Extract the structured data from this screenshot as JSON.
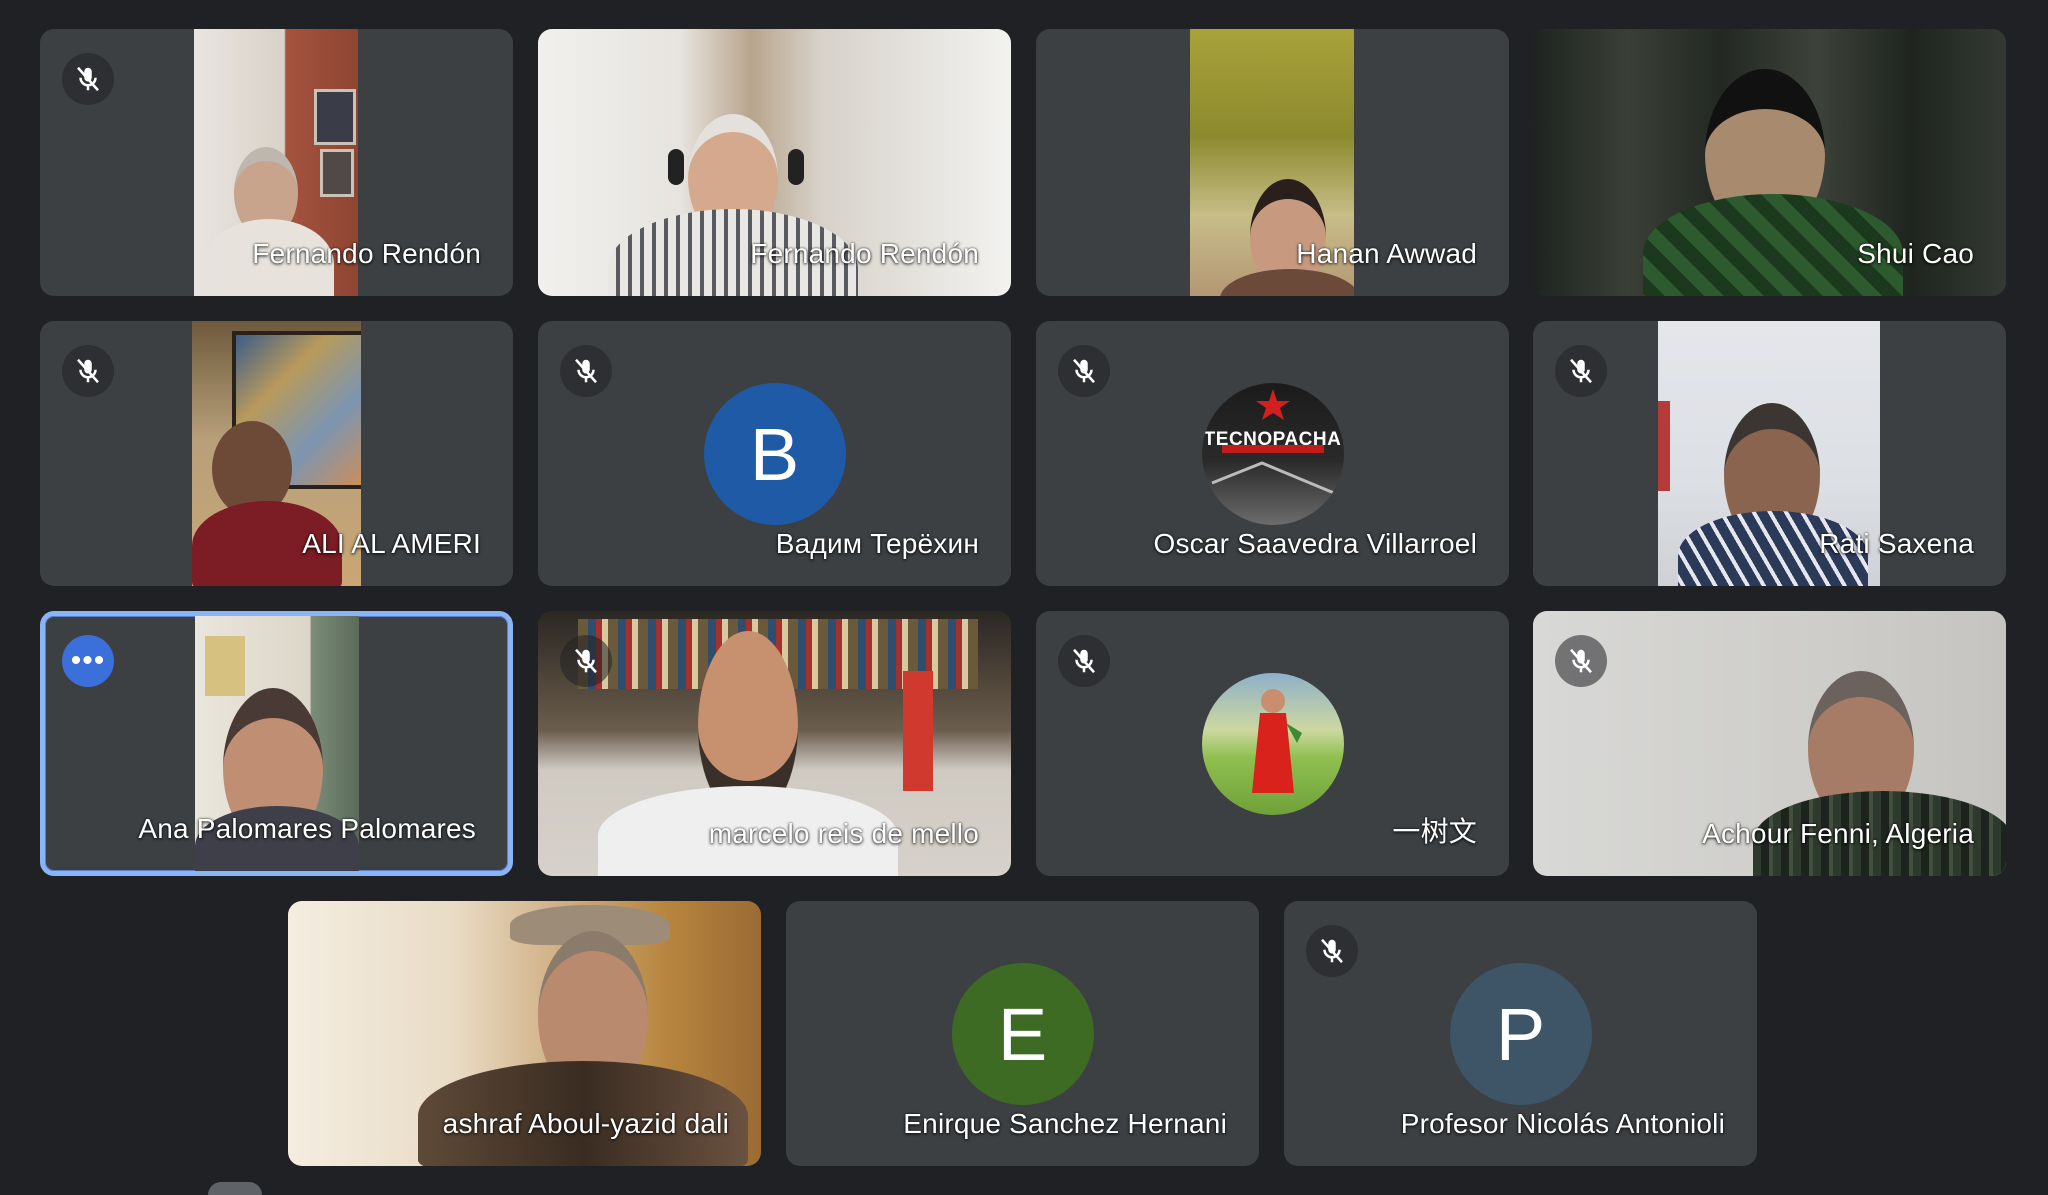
{
  "meeting": {
    "accent_color": "#8ab4f8",
    "background_color": "#202124",
    "tile_color": "#3c4043"
  },
  "participants": [
    {
      "name": "Fernando Rendón",
      "muted": true,
      "kind": "video"
    },
    {
      "name": "Fernando Rendón",
      "muted": false,
      "kind": "video"
    },
    {
      "name": "Hanan Awwad",
      "muted": false,
      "kind": "video"
    },
    {
      "name": "Shui Cao",
      "muted": false,
      "kind": "video"
    },
    {
      "name": "ALI AL AMERI",
      "muted": true,
      "kind": "video"
    },
    {
      "name": "Вадим Терёхин",
      "muted": true,
      "kind": "avatar",
      "initial": "B",
      "avatar_color": "#1f5aa6"
    },
    {
      "name": "Oscar Saavedra Villarroel",
      "muted": true,
      "kind": "avatar-image",
      "avatar_text": "TECNOPACHA"
    },
    {
      "name": "Rati Saxena",
      "muted": true,
      "kind": "video"
    },
    {
      "name": "Ana Palomares Palomares",
      "muted": false,
      "kind": "video",
      "active": true,
      "menu_icon": "more-options-icon"
    },
    {
      "name": "marcelo reis de mello",
      "muted": true,
      "kind": "video"
    },
    {
      "name": "一树文",
      "muted": true,
      "kind": "avatar-image"
    },
    {
      "name": "Achour Fenni, Algeria",
      "muted": true,
      "kind": "video"
    },
    {
      "name": "ashraf Aboul-yazid dali",
      "muted": false,
      "kind": "video"
    },
    {
      "name": "Enirque Sanchez Hernani",
      "muted": false,
      "kind": "avatar",
      "initial": "E",
      "avatar_color": "#3e6b23"
    },
    {
      "name": "Profesor Nicolás Antonioli",
      "muted": true,
      "kind": "avatar",
      "initial": "P",
      "avatar_color": "#3d5566"
    }
  ]
}
